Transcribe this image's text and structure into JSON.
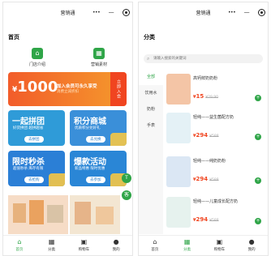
{
  "app_title": "营销通",
  "left": {
    "page_title": "首页",
    "quick_entries": [
      {
        "label": "门店介绍",
        "icon": "store-icon"
      },
      {
        "label": "营销素材",
        "icon": "gift-icon"
      }
    ],
    "vip_banner": {
      "currency": "¥",
      "amount": "1000",
      "line1": "加入会员可永久享受",
      "line2": "消费立减折扣",
      "join": "立即入会"
    },
    "promos": [
      {
        "title": "一起拼团",
        "subtitle": "好货拼团 越拼越省",
        "cta": "去拼团"
      },
      {
        "title": "积分商城",
        "subtitle": "优质积分兑好礼",
        "cta": "去兑换"
      },
      {
        "title": "限时秒杀",
        "subtitle": "超值秒杀 库存有限",
        "cta": "去抢购"
      },
      {
        "title": "爆款活动",
        "subtitle": "新品特惠 限时优惠",
        "cta": "去参加"
      }
    ],
    "floating": {
      "top": "T",
      "service": "客"
    }
  },
  "right": {
    "page_title": "分类",
    "search_placeholder": "请输入搜索的关键词",
    "categories": [
      "全部",
      "饮用水",
      "奶粉",
      "手表"
    ],
    "products": [
      {
        "name": "高钙鲜奶奶粉",
        "price": "15",
        "original": "¥29.90"
      },
      {
        "name": "轻纯——益生菌配方奶",
        "price": "294",
        "original": "¥588"
      },
      {
        "name": "轻纯——纯奶奶粉",
        "price": "294",
        "original": "¥588"
      },
      {
        "name": "轻纯——儿童成长配方奶",
        "price": "294",
        "original": "¥588"
      }
    ],
    "currency": "¥"
  },
  "tabbar": [
    {
      "label": "首页",
      "icon": "home-icon"
    },
    {
      "label": "分类",
      "icon": "category-icon"
    },
    {
      "label": "购物车",
      "icon": "cart-icon"
    },
    {
      "label": "我的",
      "icon": "user-icon"
    }
  ],
  "colors": {
    "brand_green": "#2fa548",
    "price_red": "#f04520",
    "banner_orange": "#f25c2a",
    "promo_blue": "#2f9bd8"
  }
}
